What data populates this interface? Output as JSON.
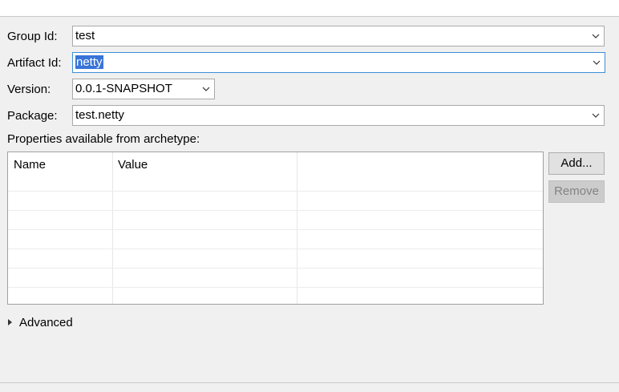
{
  "form": {
    "group_id": {
      "label": "Group Id:",
      "value": "test"
    },
    "artifact_id": {
      "label": "Artifact Id:",
      "value": "netty"
    },
    "version": {
      "label": "Version:",
      "value": "0.0.1-SNAPSHOT"
    },
    "package": {
      "label": "Package:",
      "value": "test.netty"
    }
  },
  "properties": {
    "heading": "Properties available from archetype:",
    "columns": [
      "Name",
      "Value"
    ],
    "add_label": "Add...",
    "remove_label": "Remove"
  },
  "advanced": {
    "label": "Advanced"
  },
  "icons": {
    "dropdown": "chevron-down-icon",
    "expander": "triangle-right-icon"
  },
  "colors": {
    "selection": "#3874d8",
    "focus_border": "#3b8fd9"
  }
}
